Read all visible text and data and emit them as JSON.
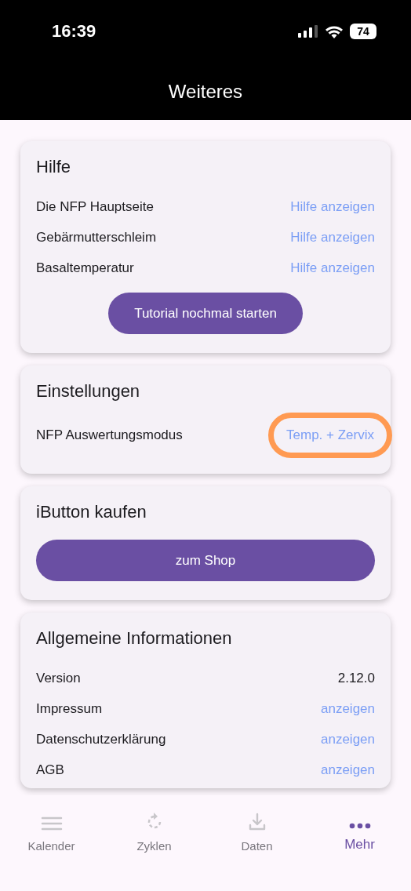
{
  "status_bar": {
    "time": "16:39",
    "battery": "74"
  },
  "header": {
    "title": "Weiteres"
  },
  "help": {
    "title": "Hilfe",
    "rows": [
      {
        "label": "Die NFP Hauptseite",
        "action": "Hilfe anzeigen"
      },
      {
        "label": "Gebärmutterschleim",
        "action": "Hilfe anzeigen"
      },
      {
        "label": "Basaltemperatur",
        "action": "Hilfe anzeigen"
      }
    ],
    "button": "Tutorial nochmal starten"
  },
  "settings": {
    "title": "Einstellungen",
    "rows": [
      {
        "label": "NFP Auswertungsmodus",
        "value": "Temp. + Zervix",
        "highlighted": true
      }
    ]
  },
  "shop": {
    "title": "iButton kaufen",
    "button": "zum Shop"
  },
  "info": {
    "title": "Allgemeine Informationen",
    "rows": [
      {
        "kind": "text",
        "label": "Version",
        "value": "2.12.0"
      },
      {
        "kind": "link",
        "label": "Impressum",
        "value": "anzeigen"
      },
      {
        "kind": "link",
        "label": "Datenschutzerklärung",
        "value": "anzeigen"
      },
      {
        "kind": "link",
        "label": "AGB",
        "value": "anzeigen"
      }
    ]
  },
  "tabs": [
    {
      "kind": "calendar",
      "label": "Kalender",
      "selected": false
    },
    {
      "kind": "cycles",
      "label": "Zyklen",
      "selected": false
    },
    {
      "kind": "data",
      "label": "Daten",
      "selected": false
    },
    {
      "kind": "more",
      "label": "Mehr",
      "selected": true
    }
  ]
}
